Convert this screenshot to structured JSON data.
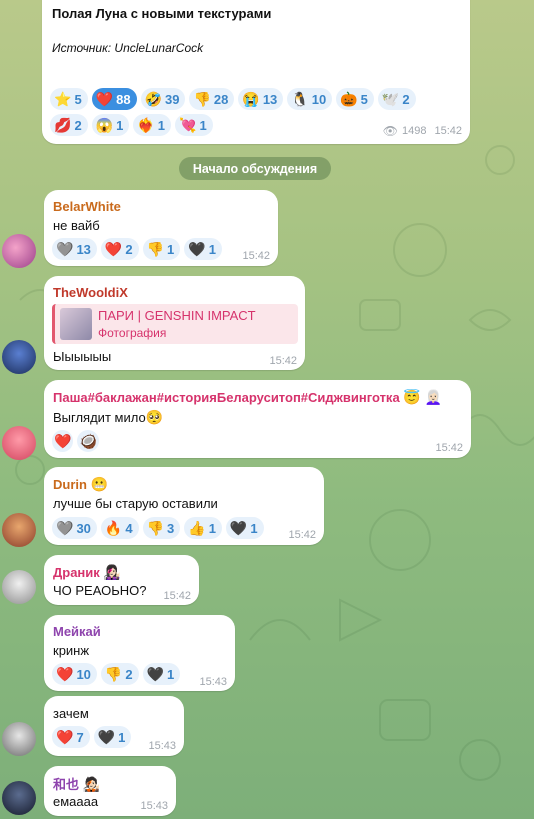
{
  "post": {
    "title": "Полая Луна с новыми текстурами",
    "source": "Источник: UncleLunarCock",
    "views": "1498",
    "time": "15:42",
    "reactions": [
      {
        "emoji": "⭐",
        "count": "5"
      },
      {
        "emoji": "❤️",
        "count": "88"
      },
      {
        "emoji": "🤣",
        "count": "39"
      },
      {
        "emoji": "👎",
        "count": "28"
      },
      {
        "emoji": "😭",
        "count": "13"
      },
      {
        "emoji": "🐧",
        "count": "10"
      },
      {
        "emoji": "🎃",
        "count": "5"
      },
      {
        "emoji": "🕊️",
        "count": "2"
      },
      {
        "emoji": "💋",
        "count": "2"
      },
      {
        "emoji": "😱",
        "count": "1"
      },
      {
        "emoji": "❤️‍🔥",
        "count": "1"
      },
      {
        "emoji": "💘",
        "count": "1"
      }
    ]
  },
  "divider": {
    "label": "Начало обсуждения"
  },
  "messages": [
    {
      "author": "BelarWhite",
      "author_color": "#c96a1c",
      "text": "не вайб",
      "time": "15:42",
      "reactions": [
        {
          "emoji": "🩶",
          "count": "13"
        },
        {
          "emoji": "❤️",
          "count": "2"
        },
        {
          "emoji": "👎",
          "count": "1"
        },
        {
          "emoji": "🖤",
          "count": "1"
        }
      ]
    },
    {
      "author": "TheWooldiX",
      "author_color": "#c0392b",
      "reply": {
        "title": "ПАРИ | GENSHIN IMPACT",
        "subtitle": "Фотография"
      },
      "text": "Ыыыыыы",
      "time": "15:42"
    },
    {
      "author": "Паша#баклажан#историяБеларуситоп#Сиджвинготка",
      "author_emoji": "😇 👩🏻‍🦳",
      "author_color": "#d6336c",
      "text": "Выглядит мило",
      "text_emoji": "🥺",
      "time": "15:42",
      "reactions": [
        {
          "emoji": "❤️",
          "count": ""
        },
        {
          "emoji": "🥥",
          "count": ""
        }
      ]
    },
    {
      "author": "Durin",
      "author_emoji": "😬",
      "author_color": "#c96a1c",
      "text": "лучше бы старую оставили",
      "time": "15:42",
      "reactions": [
        {
          "emoji": "🩶",
          "count": "30"
        },
        {
          "emoji": "🔥",
          "count": "4"
        },
        {
          "emoji": "👎",
          "count": "3"
        },
        {
          "emoji": "👍",
          "count": "1"
        },
        {
          "emoji": "🖤",
          "count": "1"
        }
      ]
    },
    {
      "author": "Драник",
      "author_emoji": "👩🏻‍🎤",
      "author_color": "#d6336c",
      "text": "ЧО РЕАОЬНО?",
      "time": "15:42"
    },
    {
      "author": "Мейкай",
      "author_color": "#8e44ad",
      "text": "кринж",
      "time": "15:43",
      "reactions": [
        {
          "emoji": "❤️",
          "count": "10"
        },
        {
          "emoji": "👎",
          "count": "2"
        },
        {
          "emoji": "🖤",
          "count": "1"
        }
      ]
    },
    {
      "text": "зачем",
      "time": "15:43",
      "reactions": [
        {
          "emoji": "❤️",
          "count": "7"
        },
        {
          "emoji": "🖤",
          "count": "1"
        }
      ]
    },
    {
      "author": "和也",
      "author_emoji": "🧑🏻‍🎤",
      "author_color": "#8e44ad",
      "text": "емаааа",
      "time": "15:43"
    }
  ]
}
